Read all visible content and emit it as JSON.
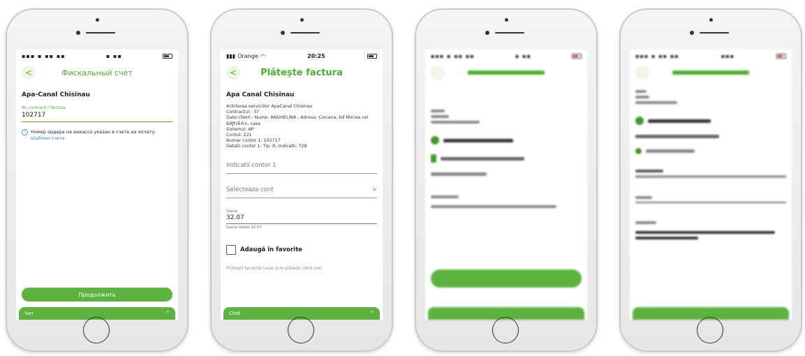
{
  "phone1": {
    "nav_title": "Фискальный счет",
    "back_glyph": "<",
    "section_title": "Apa-Canal Chisinau",
    "field_label": "Nr. contract / factura",
    "field_value": "102717",
    "note_text": "Номер ордера на инкассо указан в счете на оплату.",
    "note_link": "Шаблон счета",
    "continue_label": "Продолжить",
    "chat_label": "Чат",
    "chat_icon": "chevron-up-icon",
    "chat_glyph": "^"
  },
  "phone2": {
    "carrier": "Orange",
    "time": "20:25",
    "nav_title": "Plătește factura",
    "back_glyph": "<",
    "section_title": "Apa Canal Chisinau",
    "details": [
      "Achitarea serviciilor ApaCanal Chisinau",
      "Contractul:: 37",
      "Date client:: Nume:        ANGHELINA         , Adresa: Ciocana, bd Mircea cel BÄƒtrÃ®n, casa",
      "Sistemul: AP",
      "Contul: 221",
      "Numar contor 1: 102717",
      "Detalii contor 1: Tip: R, Indicatii: 728"
    ],
    "indicatii_placeholder": "Indicatii contor 1",
    "select_placeholder": "Selecteaza cont",
    "select_glyph": ">",
    "suma_label": "Suma",
    "suma_value": "32.07",
    "suma_total": "Suma totala 32.07",
    "favorite_label": "Adaugă în favorite",
    "promo": "Primești facturile lunar și le plătești când vrei",
    "chat_label": "Chat",
    "chat_glyph": "^"
  },
  "colors": {
    "accent": "#5db33f",
    "title_green": "#4cae2f",
    "link_blue": "#2f86c8"
  }
}
